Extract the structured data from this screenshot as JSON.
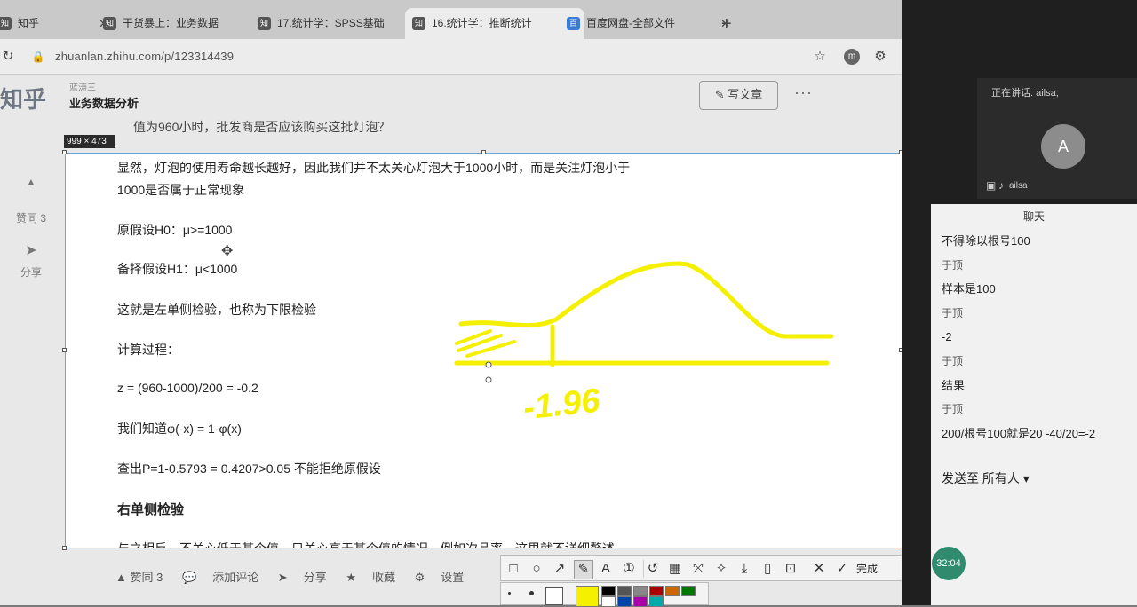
{
  "browser": {
    "tabs": [
      {
        "label": "知乎",
        "favicon": "zhihu"
      },
      {
        "label": "干货暴上：业务数据",
        "favicon": "zhihu"
      },
      {
        "label": "17.统计学：SPSS基础",
        "favicon": "zhihu"
      },
      {
        "label": "16.统计学：推断统计",
        "favicon": "zhihu",
        "active": true
      },
      {
        "label": "百度网盘-全部文件",
        "favicon": "baidu"
      }
    ],
    "new_tab": "+",
    "url": "zhuanlan.zhihu.com/p/123314439"
  },
  "zhihu": {
    "logo": "知乎",
    "author_small": "蓝涛三",
    "column_name": "业务数据分析",
    "write_button": "写文章",
    "more": "···",
    "question_line": "值为960小时，批发商是否应该购买这批灯泡？",
    "side_like": "赞同 3",
    "side_share": "分享",
    "bottom_bar": [
      "▲ 赞同 3",
      "添加评论",
      "分享",
      "收藏",
      "设置"
    ]
  },
  "snip": {
    "dimensions": "999 × 473",
    "lines": [
      "显然，灯泡的使用寿命越长越好，因此我们并不太关心灯泡大于1000小时，而是关注灯泡小于",
      "1000是否属于正常现象",
      "原假设H0：μ>=1000",
      "备择假设H1：μ<1000",
      "这就是左单侧检验，也称为下限检验",
      "计算过程：",
      "z = (960-1000)/200 = -0.2",
      "我们知道φ(-x) = 1-φ(x)",
      "查出P=1-0.5793 = 0.4207>0.05 不能拒绝原假设",
      "右单侧检验",
      "与之相反，不关心低于某个值，只关心高于某个值的情况，例如次品率，这里就不详细赘述"
    ],
    "handwriting": "-1.96",
    "ink_color": "#f5f000"
  },
  "toolbar": {
    "tools": [
      "rect-icon",
      "ellipse-icon",
      "arrow-icon",
      "pen-icon",
      "text-icon",
      "number-icon",
      "undo-icon",
      "mosaic-icon",
      "pin-icon",
      "magic-icon",
      "download-icon",
      "copy-icon",
      "bookmark-icon",
      "close-icon"
    ],
    "done_label": "完成",
    "palette": [
      "#f5f000",
      "#000000",
      "#555555",
      "#888888",
      "#aa0000",
      "#cc6600",
      "#007700",
      "#0044aa",
      "#aa00aa",
      "#00aaaa"
    ]
  },
  "meeting": {
    "speaking": "正在讲话: ailsa;",
    "avatar_letter": "A",
    "video_name": "ailsa",
    "chat_title": "聊天",
    "messages": [
      {
        "text": "不得除以根号100",
        "sender": false
      },
      {
        "text": "于顶",
        "sender": true
      },
      {
        "text": "样本是100",
        "sender": false
      },
      {
        "text": "于顶",
        "sender": true
      },
      {
        "text": "-2",
        "sender": false
      },
      {
        "text": "于顶",
        "sender": true
      },
      {
        "text": "结果",
        "sender": false
      },
      {
        "text": "于顶",
        "sender": true
      },
      {
        "text": "200/根号100就是20  -40/20=-2",
        "sender": false
      }
    ],
    "send_to": "发送至 所有人 ▾",
    "time": "32:04"
  }
}
